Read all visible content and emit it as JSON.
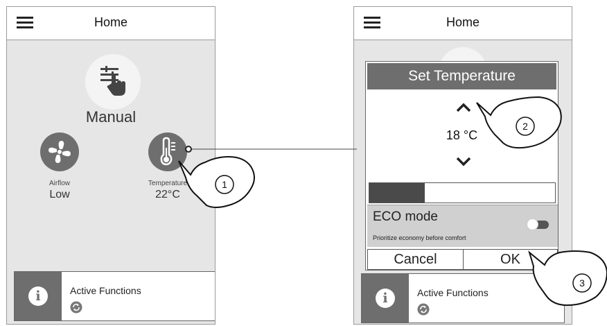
{
  "left_screen": {
    "header": {
      "title": "Home"
    },
    "mode": {
      "label": "Manual",
      "icon": "sliders-hand-icon"
    },
    "airflow": {
      "label": "Airflow",
      "value": "Low",
      "icon": "fan-icon"
    },
    "temperature": {
      "label": "Temperature",
      "value": "22°C",
      "icon": "thermometer-icon"
    },
    "active_functions": {
      "label": "Active Functions",
      "icon": "info-icon"
    }
  },
  "right_screen": {
    "header": {
      "title": "Home"
    },
    "dialog": {
      "title": "Set Temperature",
      "value": "18 °C",
      "level": 0.3,
      "eco": {
        "title": "ECO mode",
        "subtitle": "Prioritize economy before comfort",
        "enabled": false
      },
      "cancel_label": "Cancel",
      "ok_label": "OK"
    },
    "active_functions": {
      "label": "Active Functions",
      "icon": "info-icon"
    }
  },
  "callouts": [
    "1",
    "2",
    "3"
  ],
  "colors": {
    "accent_gray": "#6e6e6e",
    "panel": "#e6e6e6",
    "eco_bg": "#d0d0d0"
  }
}
